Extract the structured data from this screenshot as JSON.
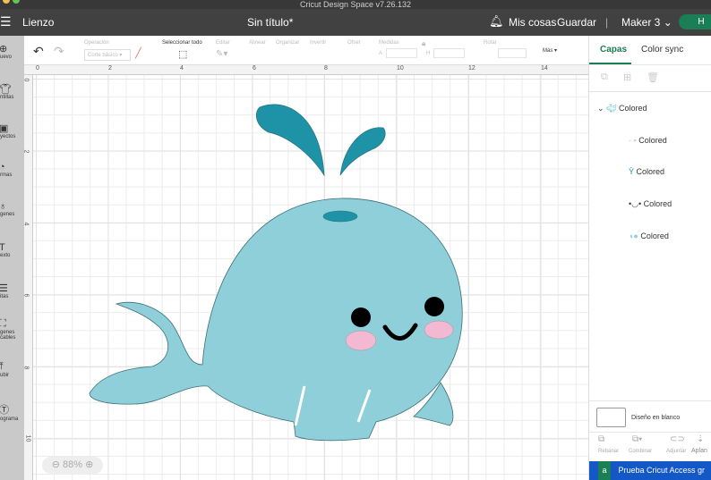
{
  "window": {
    "title": "Cricut Design Space v7.26.132"
  },
  "header": {
    "menu": "Lienzo",
    "doc_title": "Sin título*",
    "my_stuff": "Mis cosas",
    "save": "Guardar",
    "separator": "|",
    "machine": "Maker 3",
    "make_button": "H"
  },
  "toolbar": {
    "operation_label": "Operación",
    "operation_value": "Corte básico",
    "select_all": "Seleccionar todo",
    "edit": "Editar",
    "align": "Alinear",
    "arrange": "Organizar",
    "flip": "Invertir",
    "offset": "Ofset",
    "size": "Medidas",
    "w_label": "A",
    "h_label": "H",
    "rotate": "Rotar",
    "more": "Más"
  },
  "sidebar": [
    "uevo",
    "ntillas",
    "yectos",
    "rmas",
    "genes",
    "exto",
    "itas",
    "genes\ncables",
    "ubir",
    "ograma"
  ],
  "ruler": {
    "top": [
      "0",
      "2",
      "4",
      "6",
      "8",
      "10",
      "12",
      "14"
    ],
    "left": [
      "0",
      "2",
      "4",
      "6",
      "8",
      "10"
    ]
  },
  "zoom": {
    "level": "88%"
  },
  "panel": {
    "tabs": [
      "Capas",
      "Color sync"
    ],
    "group": "Colored",
    "layers": [
      "Colored",
      "Colored",
      "Colored",
      "Colored"
    ],
    "blank": "Diseño en blanco",
    "actions": [
      "Rebanar",
      "Combinar",
      "Adjuntar",
      "Aplan"
    ],
    "promo": "Prueba Cricut Access gr"
  },
  "colors": {
    "accent": "#1a7f55",
    "body": "#8fcfd9",
    "spout": "#1e93a8",
    "cheek": "#f3b8d2"
  }
}
